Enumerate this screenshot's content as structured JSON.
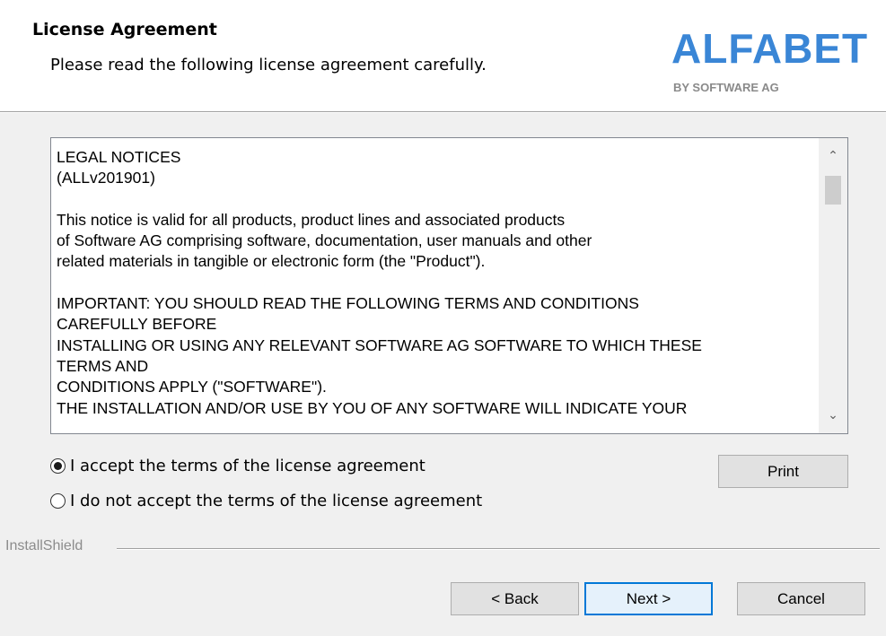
{
  "header": {
    "title": "License Agreement",
    "subtitle": "Please read the following license agreement carefully.",
    "logo": {
      "word": "ALFABET",
      "sub": "BY SOFTWARE AG",
      "color": "#3a86d6"
    }
  },
  "license": {
    "lines": [
      "LEGAL NOTICES",
      "(ALLv201901)",
      "",
      "This notice is valid for all products, product lines and associated products",
      "of Software AG comprising software, documentation, user manuals and other",
      "related materials in tangible or electronic form (the \"Product\").",
      "",
      "IMPORTANT: YOU SHOULD READ THE FOLLOWING TERMS AND CONDITIONS",
      "CAREFULLY BEFORE",
      "INSTALLING OR USING ANY RELEVANT SOFTWARE AG SOFTWARE TO WHICH THESE",
      "TERMS AND",
      "CONDITIONS APPLY (\"SOFTWARE\").",
      "THE INSTALLATION AND/OR USE BY YOU OF ANY SOFTWARE WILL INDICATE YOUR"
    ]
  },
  "options": {
    "accept": {
      "label": "I accept the terms of the license agreement",
      "selected": true
    },
    "decline": {
      "label": "I do not accept the terms of the license agreement",
      "selected": false
    }
  },
  "buttons": {
    "print": "Print",
    "back": "< Back",
    "next": "Next >",
    "cancel": "Cancel"
  },
  "footer": {
    "brand": "InstallShield"
  }
}
